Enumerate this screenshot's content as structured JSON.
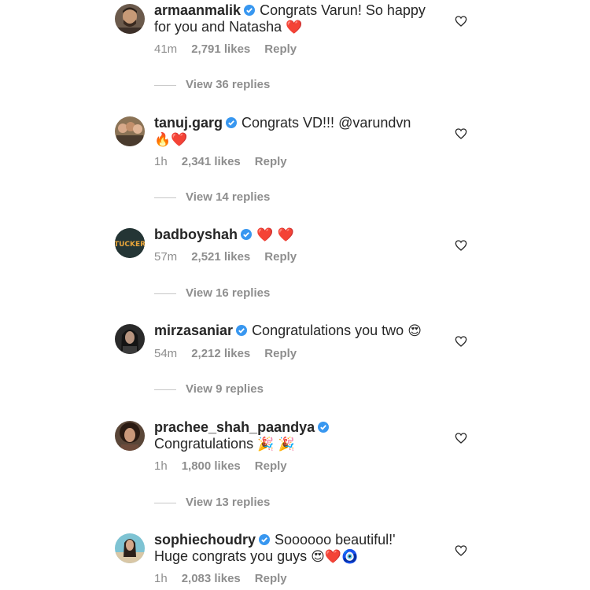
{
  "comments": [
    {
      "username": "armaanmalik",
      "text_line1": "Congrats Varun! So happy",
      "text_line2": "for you and Natasha ",
      "emoji_line1": "",
      "emoji_line2": "❤️",
      "time": "41m",
      "likes": "2,791 likes",
      "reply": "Reply",
      "view_replies": "View 36 replies",
      "avatar_icon": "avatar-man-beard-icon"
    },
    {
      "username": "tanuj.garg",
      "text_line1": "Congrats VD!!! @varundvn",
      "text_line2": "",
      "emoji_line1": "",
      "emoji_line2": "🔥❤️",
      "time": "1h",
      "likes": "2,341 likes",
      "reply": "Reply",
      "view_replies": "View 14 replies",
      "avatar_icon": "avatar-group-icon"
    },
    {
      "username": "badboyshah",
      "text_line1": "",
      "text_line2": "",
      "emoji_line1": "❤️ ❤️",
      "emoji_line2": "",
      "time": "57m",
      "likes": "2,521 likes",
      "reply": "Reply",
      "view_replies": "View 16 replies",
      "avatar_icon": "avatar-logo-icon",
      "avatar_text": "TUCKER"
    },
    {
      "username": "mirzasaniar",
      "text_line1": "Congratulations you two ",
      "text_line2": "",
      "emoji_line1": "😍",
      "emoji_line2": "",
      "time": "54m",
      "likes": "2,212 likes",
      "reply": "Reply",
      "view_replies": "View 9 replies",
      "avatar_icon": "avatar-woman-dark-icon"
    },
    {
      "username": "prachee_shah_paandya",
      "text_line1": "",
      "text_line2": "Congratulations ",
      "emoji_line1": "",
      "emoji_line2": "🎉 🎉",
      "time": "1h",
      "likes": "1,800 likes",
      "reply": "Reply",
      "view_replies": "View 13 replies",
      "avatar_icon": "avatar-woman-curly-icon"
    },
    {
      "username": "sophiechoudry",
      "text_line1": "Soooooo beautiful!'",
      "text_line2": "Huge congrats you guys ",
      "emoji_line1": "",
      "emoji_line2": "😍❤️🧿",
      "time": "1h",
      "likes": "2,083 likes",
      "reply": "Reply",
      "view_replies": "",
      "avatar_icon": "avatar-woman-beach-icon"
    }
  ],
  "colors": {
    "username": "#262626",
    "meta": "#8e8e8e",
    "verified": "#3897f0",
    "divider": "#c7c7c7"
  }
}
